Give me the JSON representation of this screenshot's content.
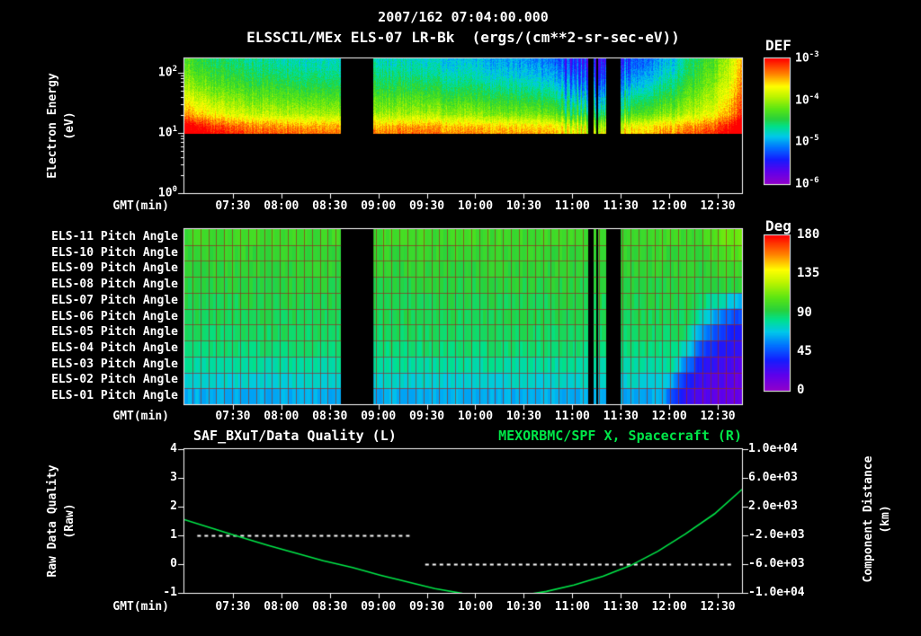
{
  "header": {
    "title": "2007/162 07:04:00.000",
    "subtitle": "ELSSCIL/MEx ELS-07 LR-Bk  (ergs/(cm**2-sr-sec-eV))"
  },
  "time_axis": {
    "label": "GMT(min)",
    "start": "07:00",
    "end": "12:45",
    "tick_labels": [
      "07:30",
      "08:00",
      "08:30",
      "09:00",
      "09:30",
      "10:00",
      "10:30",
      "11:00",
      "11:30",
      "12:00",
      "12:30"
    ]
  },
  "energy_panel": {
    "ylabel_line1": "Electron Energy",
    "ylabel_line2": "(eV)",
    "ytick_labels": [
      "10^2",
      "10^1",
      "10^0"
    ],
    "colorbar": {
      "title": "DEF",
      "tick_labels": [
        "10^-3",
        "10^-4",
        "10^-5",
        "10^-6"
      ]
    }
  },
  "pitch_panel": {
    "row_labels": [
      "ELS-11 Pitch Angle",
      "ELS-10 Pitch Angle",
      "ELS-09 Pitch Angle",
      "ELS-08 Pitch Angle",
      "ELS-07 Pitch Angle",
      "ELS-06 Pitch Angle",
      "ELS-05 Pitch Angle",
      "ELS-04 Pitch Angle",
      "ELS-03 Pitch Angle",
      "ELS-02 Pitch Angle",
      "ELS-01 Pitch Angle"
    ],
    "colorbar": {
      "title": "Deg",
      "tick_labels": [
        "180",
        "135",
        "90",
        "45",
        "0"
      ]
    }
  },
  "line_panel": {
    "left_title": "SAF_BXuT/Data Quality (L)",
    "right_title": "MEXORBMC/SPF X, Spacecraft (R)",
    "left_ylabel_line1": "Raw Data Quality",
    "left_ylabel_line2": "(Raw)",
    "right_ylabel_line1": "Component Distance",
    "right_ylabel_line2": "(km)",
    "left_tick_labels": [
      "4",
      "3",
      "2",
      "1",
      "0",
      "-1"
    ],
    "right_tick_labels": [
      "1.0e+04",
      "6.0e+03",
      "2.0e+03",
      "-2.0e+03",
      "-6.0e+03",
      "-1.0e+04"
    ]
  },
  "colors": {
    "background": "#000000",
    "axis": "#ffffff",
    "text": "#ffffff",
    "quality_series": "#ffffff",
    "spacecraft_series": "#00e648",
    "grid_line": "#8c2820"
  },
  "chart_data": [
    {
      "type": "heatmap",
      "name": "electron_energy_spectrogram",
      "title": "ELSSCIL/MEx ELS-07 LR-Bk",
      "units": "ergs/(cm**2-sr-sec-eV)",
      "t0": "07:00",
      "x_range": [
        "07:00",
        "12:45"
      ],
      "y_axis": {
        "label": "Electron Energy (eV)",
        "scale": "log",
        "range": [
          1,
          178
        ]
      },
      "color_scale": {
        "label": "DEF",
        "scale": "log",
        "range": [
          1e-06,
          0.001
        ]
      },
      "data_floor_ev": 10,
      "gaps_min": [
        [
          97,
          117
        ],
        [
          250,
          253
        ],
        [
          255,
          256
        ],
        [
          261,
          270
        ]
      ],
      "columns_note": "[minutes_after_07:00, log10_flux_at_~15eV, log10_flux_at_~150eV]",
      "columns": [
        [
          0,
          -3.15,
          -4.3
        ],
        [
          12,
          -3.3,
          -4.45
        ],
        [
          25,
          -3.5,
          -4.55
        ],
        [
          45,
          -3.65,
          -4.65
        ],
        [
          70,
          -3.7,
          -4.72
        ],
        [
          95,
          -3.75,
          -4.78
        ],
        [
          120,
          -3.75,
          -4.7
        ],
        [
          150,
          -3.72,
          -4.8
        ],
        [
          180,
          -3.8,
          -4.9
        ],
        [
          210,
          -3.85,
          -5.0
        ],
        [
          228,
          -3.9,
          -5.15
        ],
        [
          242,
          -4.1,
          -5.4
        ],
        [
          258,
          -4.2,
          -5.5
        ],
        [
          272,
          -4.0,
          -5.3
        ],
        [
          286,
          -3.9,
          -5.1
        ],
        [
          300,
          -3.8,
          -4.9
        ],
        [
          315,
          -3.7,
          -4.55
        ],
        [
          330,
          -3.5,
          -4.2
        ],
        [
          339,
          -3.25,
          -3.85
        ],
        [
          345,
          -3.0,
          -3.55
        ]
      ]
    },
    {
      "type": "heatmap",
      "name": "els_pitch_angles",
      "t0": "07:00",
      "x_range": [
        "07:00",
        "12:45"
      ],
      "color_scale": {
        "label": "Deg",
        "scale": "linear",
        "range": [
          0,
          180
        ]
      },
      "gaps_min": [
        [
          97,
          117
        ],
        [
          250,
          253
        ],
        [
          255,
          256
        ],
        [
          261,
          270
        ]
      ],
      "rows_note": "points are [minutes_after_07:00, pitch_angle_deg]; rows listed top (ELS-11) to bottom (ELS-01)",
      "rows": [
        {
          "label": "ELS-11",
          "points": [
            [
              0,
              100
            ],
            [
              320,
              100
            ],
            [
              345,
              115
            ]
          ]
        },
        {
          "label": "ELS-10",
          "points": [
            [
              0,
              97
            ],
            [
              320,
              97
            ],
            [
              345,
              108
            ]
          ]
        },
        {
          "label": "ELS-09",
          "points": [
            [
              0,
              95
            ],
            [
              320,
              95
            ],
            [
              345,
              102
            ]
          ]
        },
        {
          "label": "ELS-08",
          "points": [
            [
              0,
              93
            ],
            [
              320,
              93
            ],
            [
              345,
              95
            ]
          ]
        },
        {
          "label": "ELS-07",
          "points": [
            [
              0,
              91
            ],
            [
              315,
              91
            ],
            [
              335,
              75
            ],
            [
              345,
              62
            ]
          ]
        },
        {
          "label": "ELS-06",
          "points": [
            [
              0,
              90
            ],
            [
              312,
              90
            ],
            [
              331,
              58
            ],
            [
              345,
              42
            ]
          ]
        },
        {
          "label": "ELS-05",
          "points": [
            [
              0,
              88
            ],
            [
              308,
              88
            ],
            [
              327,
              48
            ],
            [
              345,
              32
            ]
          ]
        },
        {
          "label": "ELS-04",
          "points": [
            [
              0,
              86
            ],
            [
              305,
              86
            ],
            [
              323,
              40
            ],
            [
              345,
              26
            ]
          ]
        },
        {
          "label": "ELS-03",
          "points": [
            [
              0,
              80
            ],
            [
              302,
              80
            ],
            [
              319,
              34
            ],
            [
              345,
              21
            ]
          ]
        },
        {
          "label": "ELS-02",
          "points": [
            [
              0,
              73
            ],
            [
              298,
              73
            ],
            [
              315,
              29
            ],
            [
              345,
              16
            ]
          ]
        },
        {
          "label": "ELS-01",
          "points": [
            [
              0,
              64
            ],
            [
              295,
              64
            ],
            [
              311,
              26
            ],
            [
              345,
              13
            ]
          ]
        }
      ]
    },
    {
      "type": "line",
      "name": "quality_and_spacecraft_x",
      "t0": "07:00",
      "x_range": [
        "07:00",
        "12:45"
      ],
      "left_axis": {
        "label": "Raw Data Quality (Raw)",
        "range": [
          -1,
          4
        ]
      },
      "right_axis": {
        "label": "Component Distance (km)",
        "range": [
          -10000,
          10000
        ]
      },
      "series": [
        {
          "name": "SAF_BXuT/Data Quality",
          "axis": "left",
          "style": "dashed",
          "color": "#ffffff",
          "segments_note": "[start_min, end_min, quality_value]",
          "segments": [
            [
              8,
              140,
              1
            ],
            [
              149,
              339,
              0
            ]
          ]
        },
        {
          "name": "MEXORBMC/SPF X, Spacecraft",
          "axis": "right",
          "style": "solid",
          "color": "#00e648",
          "points_note": "[minutes_after_07:00, X_component_km]",
          "points": [
            [
              0,
              200
            ],
            [
              17,
              -1000
            ],
            [
              34,
              -2200
            ],
            [
              52,
              -3400
            ],
            [
              69,
              -4480
            ],
            [
              86,
              -5520
            ],
            [
              104,
              -6480
            ],
            [
              121,
              -7520
            ],
            [
              138,
              -8480
            ],
            [
              155,
              -9400
            ],
            [
              172,
              -10080
            ],
            [
              190,
              -10450
            ],
            [
              207,
              -10400
            ],
            [
              224,
              -9800
            ],
            [
              241,
              -8900
            ],
            [
              259,
              -7700
            ],
            [
              276,
              -6200
            ],
            [
              293,
              -4200
            ],
            [
              310,
              -1800
            ],
            [
              328,
              1000
            ],
            [
              345,
              4400
            ]
          ]
        }
      ]
    }
  ]
}
